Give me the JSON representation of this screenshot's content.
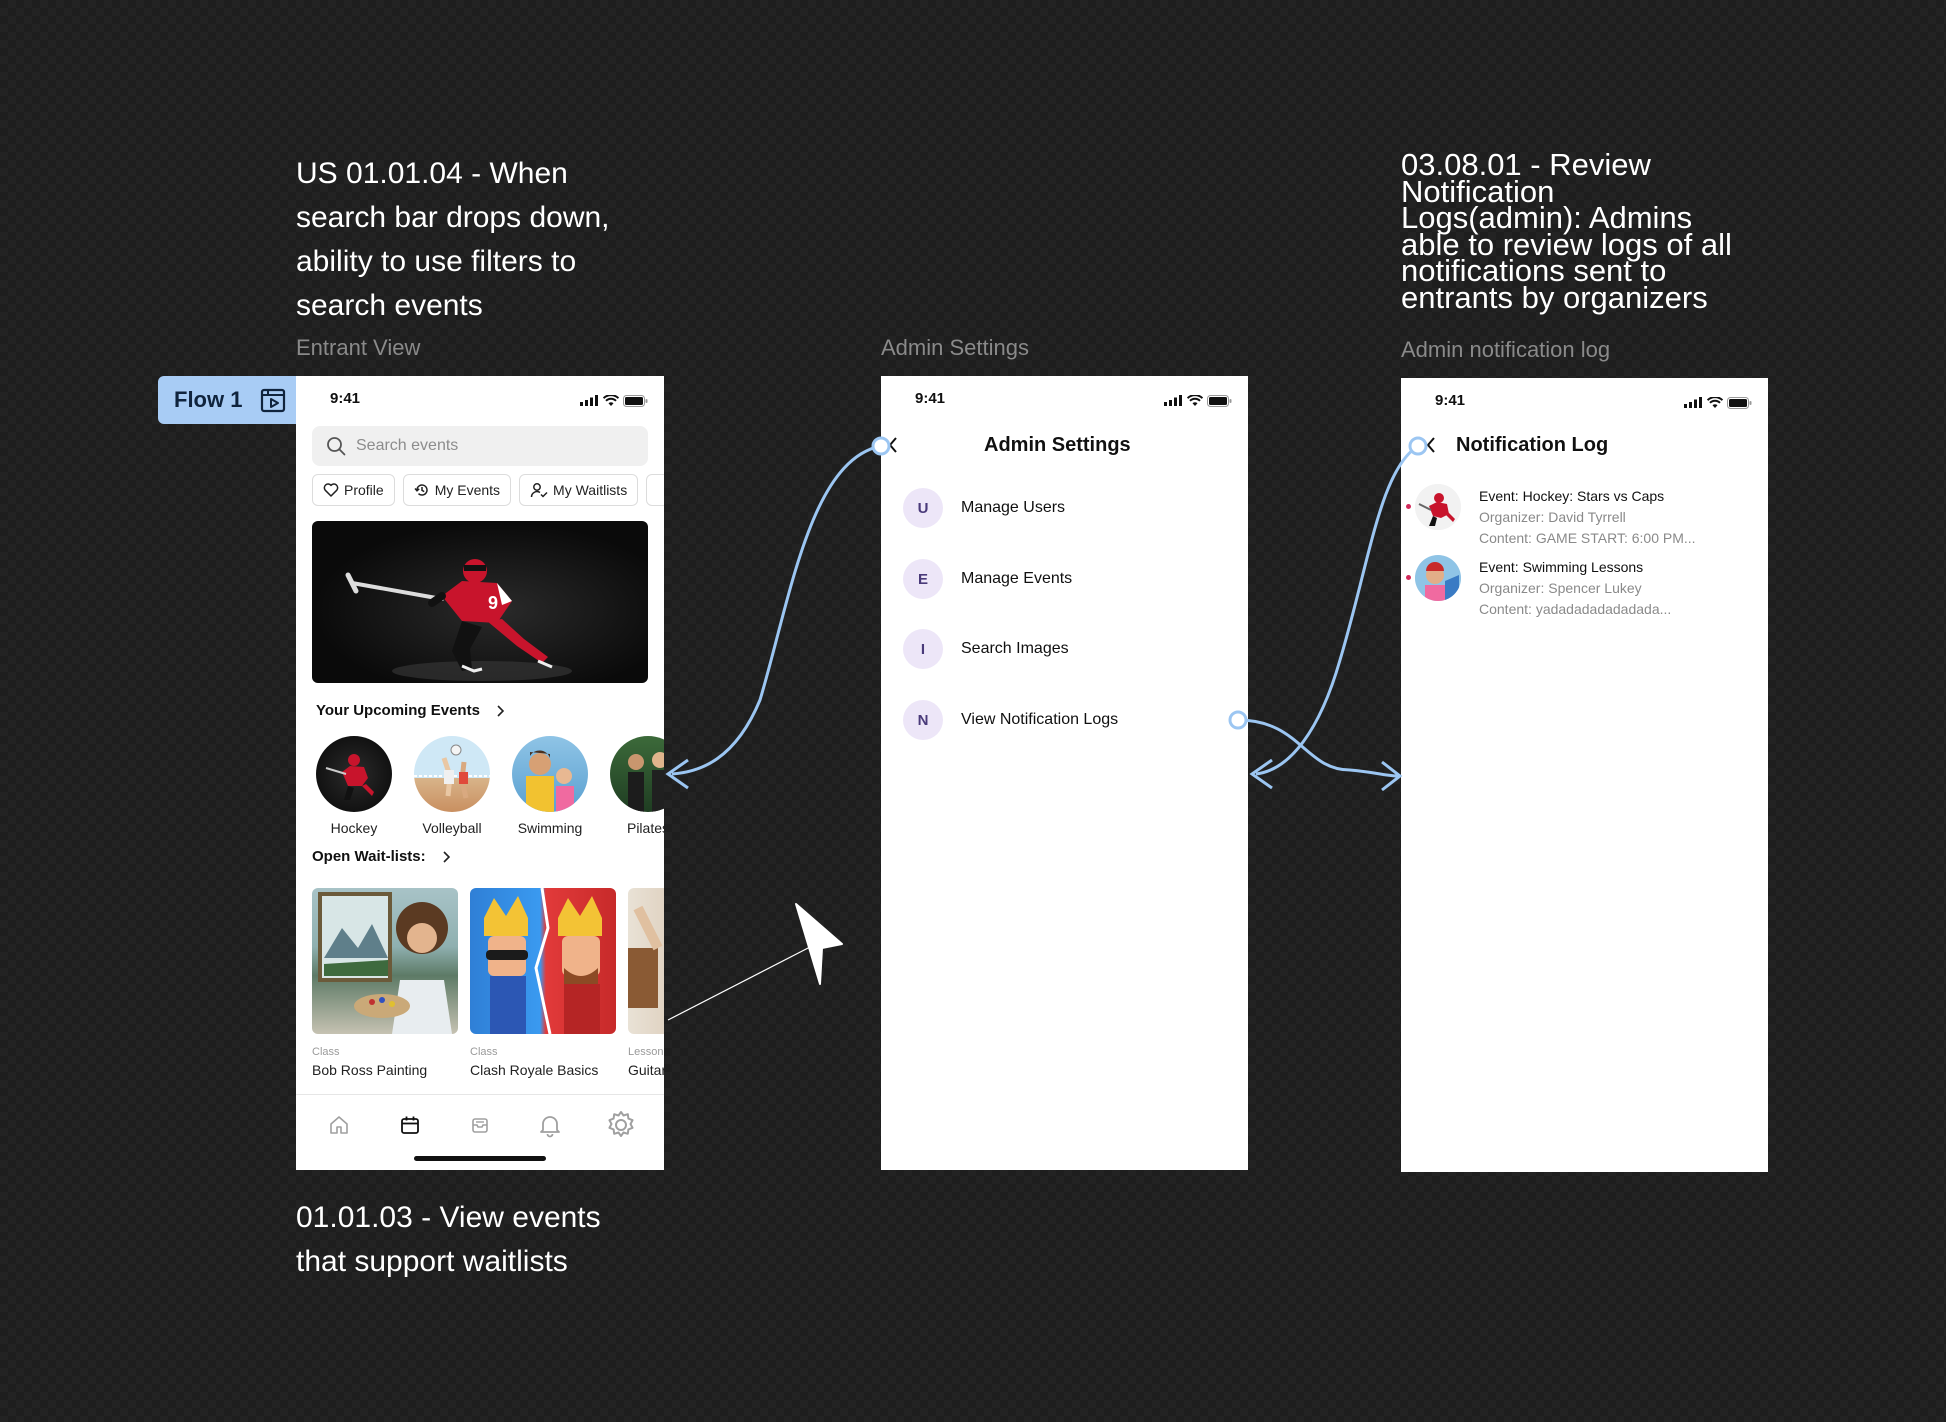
{
  "canvas": {
    "notes": {
      "search_filter": "US 01.01.04 - When search bar drops down, ability to use filters to search events",
      "view_waitlists": "01.01.03 - View events that support waitlists",
      "review_logs": "03.08.01 - Review Notification Logs(admin): Admins able to review logs of all notifications sent to entrants by organizers"
    },
    "frame_labels": {
      "entrant": "Entrant View",
      "admin": "Admin Settings",
      "notif": "Admin notification log"
    },
    "flow": {
      "label": "Flow 1"
    },
    "connector_color": "#9cc6f2"
  },
  "entrant": {
    "time": "9:41",
    "search_placeholder": "Search events",
    "chips": [
      {
        "label": "Profile",
        "icon": "heart-icon"
      },
      {
        "label": "My Events",
        "icon": "history-icon"
      },
      {
        "label": "My Waitlists",
        "icon": "user-check-icon"
      }
    ],
    "upcoming_title": "Your Upcoming Events",
    "upcoming": [
      {
        "label": "Hockey"
      },
      {
        "label": "Volleyball"
      },
      {
        "label": "Swimming"
      },
      {
        "label": "Pilates"
      }
    ],
    "waitlists_title": "Open Wait-lists:",
    "waitlists": [
      {
        "kind": "Class",
        "name": "Bob Ross Painting"
      },
      {
        "kind": "Class",
        "name": "Clash Royale Basics"
      },
      {
        "kind": "Lesson",
        "name": "Guitar"
      }
    ],
    "tabs": [
      "home-icon",
      "calendar-icon",
      "inbox-icon",
      "bell-icon",
      "settings-icon"
    ]
  },
  "admin": {
    "time": "9:41",
    "title": "Admin Settings",
    "items": [
      {
        "letter": "U",
        "label": "Manage Users"
      },
      {
        "letter": "E",
        "label": "Manage Events"
      },
      {
        "letter": "I",
        "label": "Search Images"
      },
      {
        "letter": "N",
        "label": "View Notification Logs"
      }
    ]
  },
  "notif": {
    "time": "9:41",
    "title": "Notification Log",
    "items": [
      {
        "event": "Event: Hockey: Stars vs Caps",
        "organizer": "Organizer: David Tyrrell",
        "content": "Content: GAME START: 6:00 PM..."
      },
      {
        "event": "Event: Swimming Lessons",
        "organizer": "Organizer: Spencer Lukey",
        "content": "Content: yadadadadadadada..."
      }
    ]
  }
}
